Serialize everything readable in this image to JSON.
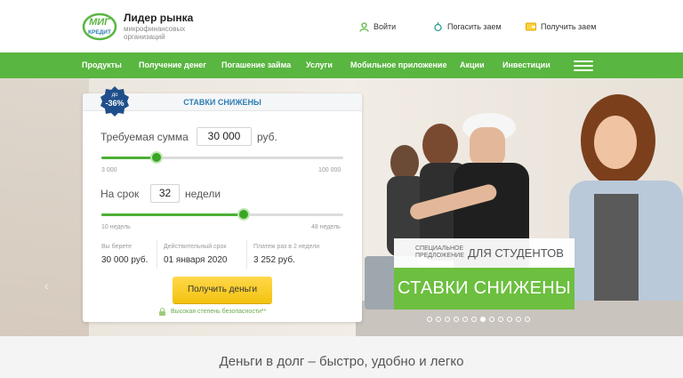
{
  "header": {
    "logo_top": "МИГ",
    "logo_bottom": "КРЕДИТ",
    "brand_title": "Лидер рынка",
    "brand_subtitle": "микрофинансовых организаций",
    "login": "Войти",
    "repay": "Погасить заем",
    "get_loan": "Получить заем"
  },
  "nav": {
    "items": [
      "Продукты",
      "Получение денег",
      "Погашение займа",
      "Услуги",
      "Мобильное приложение",
      "Акции",
      "Инвестиции"
    ]
  },
  "calculator": {
    "title": "СТАВКИ СНИЖЕНЫ",
    "badge_top": "до",
    "badge_value": "-36%",
    "amount_label": "Требуемая сумма",
    "amount_value": "30 000",
    "amount_unit": "руб.",
    "amount_min": "3 000",
    "amount_max": "100 000",
    "amount_fill_fraction": 0.227,
    "term_label": "На срок",
    "term_value": "32",
    "term_unit": "недели",
    "term_min": "10 недель",
    "term_max": "48 недель",
    "term_fill_fraction": 0.59,
    "borrow_label": "Вы берете",
    "borrow_value": "30 000 руб.",
    "until_label": "Действительный срок",
    "until_value": "01 января 2020",
    "payment_label": "Платеж раз в 2 недели",
    "payment_value": "3 252 руб.",
    "button": "Получить деньги",
    "safety": "Высокая степень безопасности**"
  },
  "promo": {
    "small_line1": "СПЕЦИАЛЬНОЕ",
    "small_line2": "ПРЕДЛОЖЕНИЕ",
    "students": "ДЛЯ СТУДЕНТОВ",
    "main": "СТАВКИ СНИЖЕНЫ"
  },
  "slider": {
    "dot_count": 12,
    "active_index": 6
  },
  "tagline": "Деньги в долг – быстро, удобно и легко",
  "colors": {
    "green": "#59b640",
    "yellow": "#f3c20f",
    "blue": "#2e7fb3"
  }
}
